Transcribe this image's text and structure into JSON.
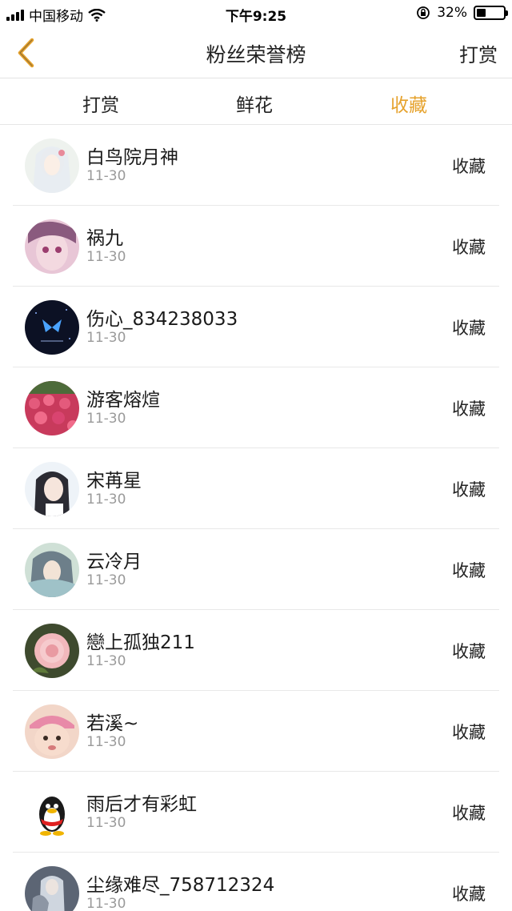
{
  "status_bar": {
    "carrier": "中国移动",
    "time": "下午9:25",
    "battery_percent": "32%",
    "battery_level": 0.32
  },
  "nav": {
    "back_icon": "chevron-left-icon",
    "title": "粉丝荣誉榜",
    "action": "打赏"
  },
  "tabs": [
    {
      "label": "打赏",
      "active": false
    },
    {
      "label": "鲜花",
      "active": false
    },
    {
      "label": "收藏",
      "active": true
    }
  ],
  "colors": {
    "accent": "#e6a22c",
    "divider": "#e8e8e8",
    "muted_text": "#9a9a9a"
  },
  "fans": [
    {
      "name": "白鸟院月神",
      "date": "11-30",
      "action": "收藏"
    },
    {
      "name": "祸九",
      "date": "11-30",
      "action": "收藏"
    },
    {
      "name": "伤心_834238033",
      "date": "11-30",
      "action": "收藏"
    },
    {
      "name": "游客熔煊",
      "date": "11-30",
      "action": "收藏"
    },
    {
      "name": "宋苒星",
      "date": "11-30",
      "action": "收藏"
    },
    {
      "name": "云冷月",
      "date": "11-30",
      "action": "收藏"
    },
    {
      "name": "戀上孤独211",
      "date": "11-30",
      "action": "收藏"
    },
    {
      "name": "若溪~",
      "date": "11-30",
      "action": "收藏"
    },
    {
      "name": "雨后才有彩虹",
      "date": "11-30",
      "action": "收藏"
    },
    {
      "name": "尘缘难尽_758712324",
      "date": "11-30",
      "action": "收藏"
    }
  ]
}
